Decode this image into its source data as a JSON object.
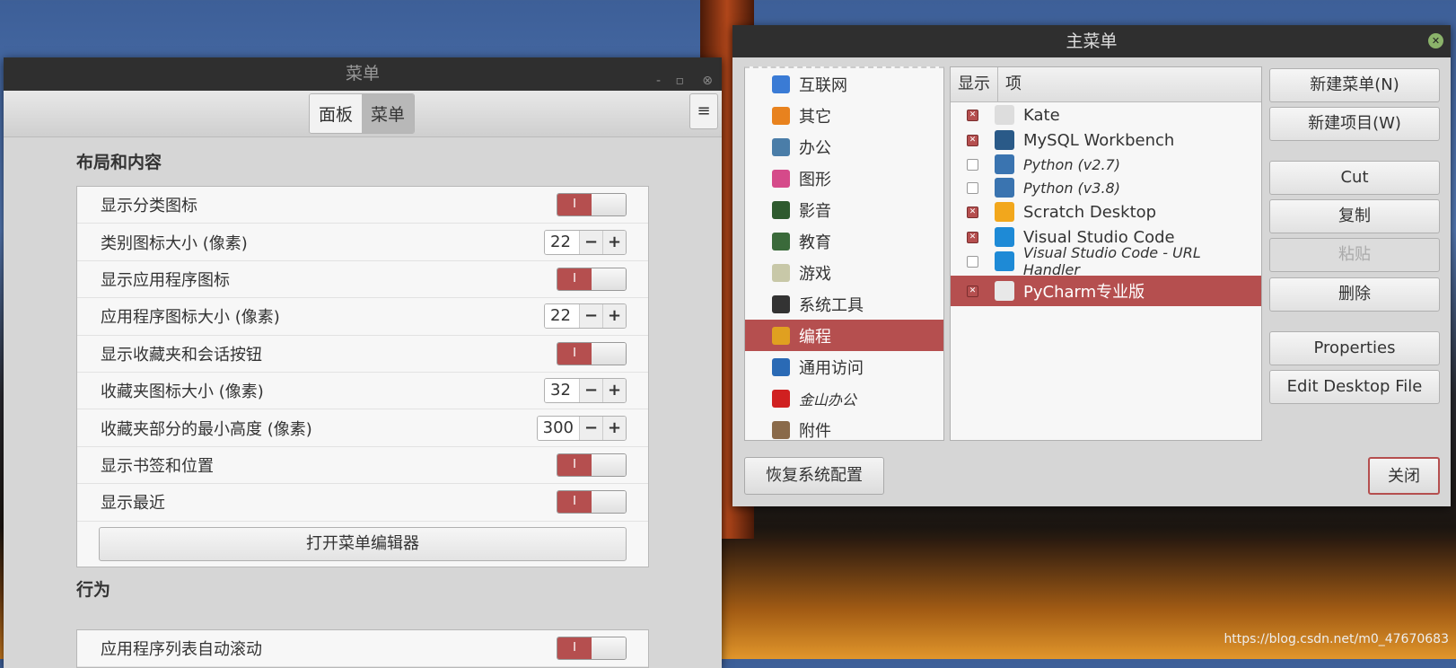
{
  "watermark": "https://blog.csdn.net/m0_47670683",
  "left_window": {
    "title": "菜单",
    "tabs": [
      "面板",
      "菜单"
    ],
    "menu_icon": "≡",
    "section1": "布局和内容",
    "rows": [
      {
        "label": "显示分类图标",
        "type": "switch",
        "on": "I"
      },
      {
        "label": "类别图标大小 (像素)",
        "type": "spin",
        "value": "22"
      },
      {
        "label": "显示应用程序图标",
        "type": "switch",
        "on": "I"
      },
      {
        "label": "应用程序图标大小 (像素)",
        "type": "spin",
        "value": "22"
      },
      {
        "label": "显示收藏夹和会话按钮",
        "type": "switch",
        "on": "I"
      },
      {
        "label": "收藏夹图标大小 (像素)",
        "type": "spin",
        "value": "32"
      },
      {
        "label": "收藏夹部分的最小高度 (像素)",
        "type": "spin",
        "value": "300"
      },
      {
        "label": "显示书签和位置",
        "type": "switch",
        "on": "I"
      },
      {
        "label": "显示最近",
        "type": "switch",
        "on": "I"
      }
    ],
    "open_editor": "打开菜单编辑器",
    "section2": "行为",
    "row2": {
      "label": "应用程序列表自动滚动",
      "on": "I"
    },
    "minus": "−",
    "plus": "+"
  },
  "right_window": {
    "title": "主菜单",
    "categories": [
      {
        "label": "互联网",
        "color": "#3a7bd5"
      },
      {
        "label": "其它",
        "color": "#e8821e"
      },
      {
        "label": "办公",
        "color": "#4a7da8"
      },
      {
        "label": "图形",
        "color": "#d54a8a"
      },
      {
        "label": "影音",
        "color": "#2e5a2e"
      },
      {
        "label": "教育",
        "color": "#3a6a3a"
      },
      {
        "label": "游戏",
        "color": "#c8c8a8"
      },
      {
        "label": "系统工具",
        "color": "#333333"
      },
      {
        "label": "编程",
        "color": "#e0a020"
      },
      {
        "label": "通用访问",
        "color": "#2a6ab5"
      },
      {
        "label": "金山办公",
        "color": "#d02020"
      },
      {
        "label": "附件",
        "color": "#8a6a4a"
      }
    ],
    "selected_category": "编程",
    "columns": [
      "显示",
      "项"
    ],
    "items": [
      {
        "name": "Kate",
        "shown": true,
        "italic": false,
        "color": "#dddddd"
      },
      {
        "name": "MySQL Workbench",
        "shown": true,
        "italic": false,
        "color": "#2a5a88"
      },
      {
        "name": "Python (v2.7)",
        "shown": false,
        "italic": true,
        "color": "#3a74b0"
      },
      {
        "name": "Python (v3.8)",
        "shown": false,
        "italic": true,
        "color": "#3a74b0"
      },
      {
        "name": "Scratch Desktop",
        "shown": true,
        "italic": false,
        "color": "#f2a71c"
      },
      {
        "name": "Visual Studio Code",
        "shown": true,
        "italic": false,
        "color": "#1e8ad6"
      },
      {
        "name": "Visual Studio Code - URL Handler",
        "shown": false,
        "italic": true,
        "color": "#1e8ad6"
      },
      {
        "name": "PyCharm专业版",
        "shown": true,
        "italic": false,
        "color": "#e8e8e8",
        "selected": true
      }
    ],
    "buttons": [
      "新建菜单(N)",
      "新建项目(W)",
      "Cut",
      "复制",
      "粘贴",
      "删除",
      "Properties",
      "Edit Desktop File"
    ],
    "restore": "恢复系统配置",
    "close": "关闭"
  }
}
